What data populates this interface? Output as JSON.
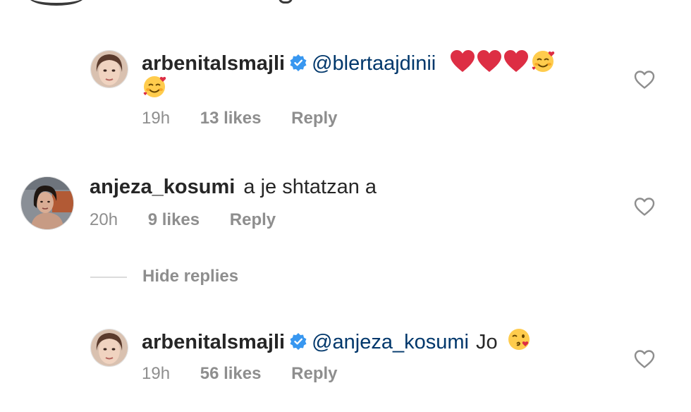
{
  "comments": [
    {
      "username": "arbenitalsmajli",
      "verified": true,
      "mention": "@blertaajdinii",
      "text": "",
      "emojis": [
        "red-heart",
        "red-heart",
        "red-heart",
        "smiling-face-with-hearts",
        "smiling-face-with-hearts"
      ],
      "time": "19h",
      "likes": "13 likes",
      "reply_label": "Reply"
    },
    {
      "username": "anjeza_kosumi",
      "verified": false,
      "mention": "",
      "text": "a je shtatzan a",
      "time": "20h",
      "likes": "9 likes",
      "reply_label": "Reply"
    },
    {
      "username": "arbenitalsmajli",
      "verified": true,
      "mention": "@anjeza_kosumi",
      "text": "Jo",
      "emojis": [
        "face-blowing-kiss"
      ],
      "time": "19h",
      "likes": "56 likes",
      "reply_label": "Reply"
    }
  ],
  "hide_replies_label": "Hide replies",
  "colors": {
    "username": "#262626",
    "mention": "#00376b",
    "meta": "#8e8e8e",
    "verified": "#3897f0",
    "heart_outline": "#8e8e8e",
    "divider": "#dbdbdb"
  }
}
